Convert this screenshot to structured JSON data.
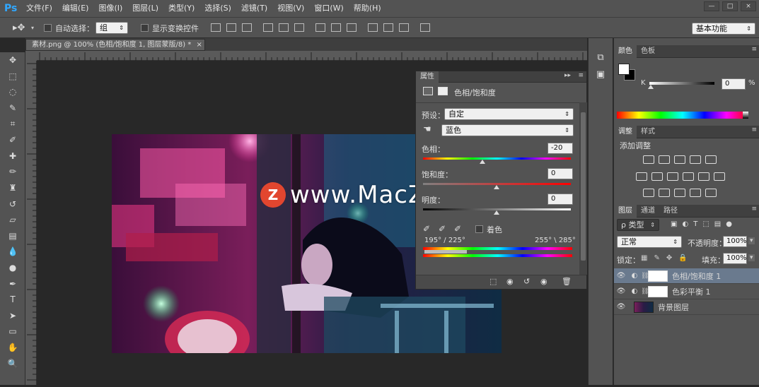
{
  "app": {
    "logo": "Ps"
  },
  "menu": [
    "文件(F)",
    "编辑(E)",
    "图像(I)",
    "图层(L)",
    "类型(Y)",
    "选择(S)",
    "滤镜(T)",
    "视图(V)",
    "窗口(W)",
    "帮助(H)"
  ],
  "window_controls": {
    "minimize": "—",
    "maximize": "□",
    "close": "×"
  },
  "options": {
    "auto_select_label": "自动选择：",
    "auto_select_value": "组",
    "show_transform_label": "显示变换控件",
    "workspace": "基本功能"
  },
  "document": {
    "tab_title": "素材.png @ 100% (色相/饱和度 1, 图层蒙版/8) *",
    "close": "×"
  },
  "watermark": {
    "logo_letter": "Z",
    "text": "www.MacZ.com"
  },
  "properties": {
    "tab": "属性",
    "title": "色相/饱和度",
    "preset_label": "预设：",
    "preset_value": "自定",
    "channel_value": "蓝色",
    "hue_label": "色相：",
    "hue_value": "-20",
    "saturation_label": "饱和度：",
    "saturation_value": "0",
    "lightness_label": "明度：",
    "lightness_value": "0",
    "colorize_label": "着色",
    "range_left": "195° / 225°",
    "range_right": "255° \\ 285°"
  },
  "color_panel": {
    "tabs": [
      "颜色",
      "色板"
    ],
    "k_label": "K",
    "k_value": "0",
    "percent": "%"
  },
  "adjustments_panel": {
    "tabs": [
      "调整",
      "样式"
    ],
    "add_label": "添加调整"
  },
  "layers_panel": {
    "tabs": [
      "图层",
      "通道",
      "路径"
    ],
    "filter_label": "ρ 类型",
    "blend_mode": "正常",
    "opacity_label": "不透明度：",
    "opacity_value": "100%",
    "lock_label": "锁定：",
    "fill_label": "填充：",
    "fill_value": "100%",
    "layers": [
      {
        "name": "色相/饱和度 1",
        "selected": true
      },
      {
        "name": "色彩平衡 1",
        "selected": false
      },
      {
        "name": "背景图层",
        "selected": false
      }
    ]
  },
  "colors": {
    "accent_blue": "#31a8ff",
    "watermark_red": "#e2462f",
    "selected_layer": "#6a7a8e"
  }
}
